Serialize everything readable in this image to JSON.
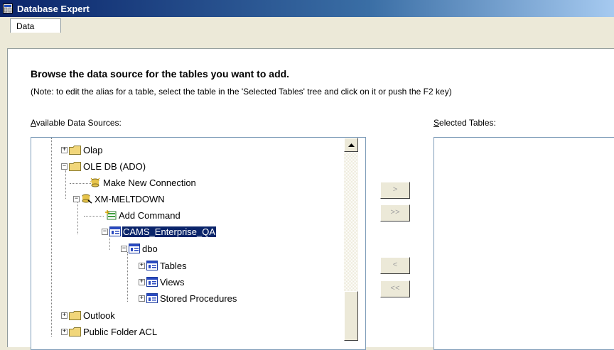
{
  "window": {
    "title": "Database Expert"
  },
  "tabs": [
    {
      "label": "Data"
    }
  ],
  "main": {
    "heading": "Browse the data source for the tables you want to add.",
    "note": "(Note: to edit the alias for a table, select the table in the 'Selected Tables' tree and click on it or push the F2 key)",
    "available": {
      "accesskey": "A",
      "rest": "vailable Data Sources:"
    },
    "selected": {
      "accesskey": "S",
      "rest": "elected Tables:"
    }
  },
  "tree": {
    "olap": "Olap",
    "oledb": "OLE DB (ADO)",
    "make_new_connection": "Make New Connection",
    "server": "XM-MELTDOWN",
    "add_command": "Add Command",
    "database": "CAMS_Enterprise_QA",
    "schema": "dbo",
    "tables": "Tables",
    "views": "Views",
    "stored_procedures": "Stored Procedures",
    "outlook": "Outlook",
    "public_folder_acl": "Public Folder ACL"
  },
  "buttons": {
    "add": ">",
    "add_all": ">>",
    "remove": "<",
    "remove_all": "<<"
  }
}
